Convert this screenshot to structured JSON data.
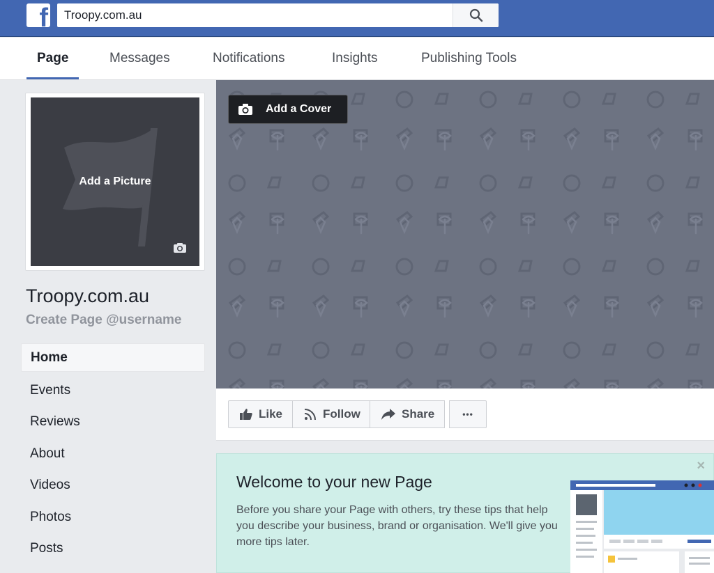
{
  "topbar": {
    "logo": "f",
    "search_value": "Troopy.com.au",
    "search_icon": "search-icon"
  },
  "tabs": [
    {
      "label": "Page",
      "active": true
    },
    {
      "label": "Messages"
    },
    {
      "label": "Notifications"
    },
    {
      "label": "Insights"
    },
    {
      "label": "Publishing Tools"
    }
  ],
  "profile": {
    "picture_label": "Add a Picture",
    "camera_icon": "camera-icon",
    "name": "Troopy.com.au",
    "username_cta": "Create Page @username"
  },
  "nav": {
    "items": [
      {
        "label": "Home",
        "active": true
      },
      {
        "label": "Events"
      },
      {
        "label": "Reviews"
      },
      {
        "label": "About"
      },
      {
        "label": "Videos"
      },
      {
        "label": "Photos"
      },
      {
        "label": "Posts"
      }
    ]
  },
  "cover": {
    "add_cover_label": "Add a Cover"
  },
  "actions": {
    "like": "Like",
    "follow": "Follow",
    "share": "Share",
    "more": "•••"
  },
  "welcome": {
    "title": "Welcome to your new Page",
    "text": "Before you share your Page with others, try these tips that help you describe your business, brand or organisation. We'll give you more tips later.",
    "close": "×"
  },
  "colors": {
    "brand": "#4267b2",
    "cover": "#6d7382",
    "welcome_bg": "#d0efe9"
  }
}
